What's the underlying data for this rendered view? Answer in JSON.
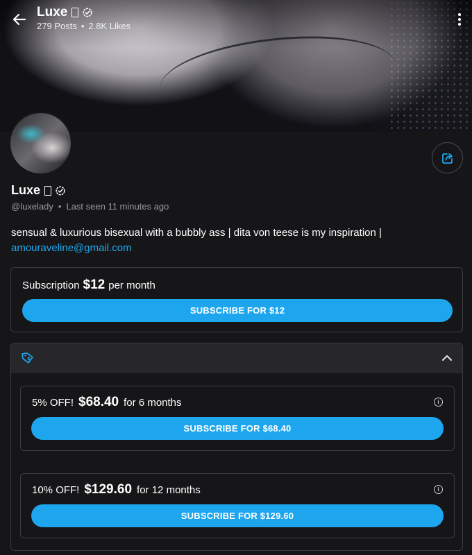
{
  "header": {
    "name": "Luxe",
    "posts": "279 Posts",
    "separator": "•",
    "likes": "2.8K Likes"
  },
  "profile": {
    "name": "Luxe",
    "handle": "@luxelady",
    "separator": "•",
    "last_seen": "Last seen 11 minutes ago",
    "bio_text": "sensual & luxurious bisexual with a bubbly ass | dita von teese is my inspiration |",
    "bio_link": "amouraveline@gmail.com"
  },
  "subscription": {
    "label": "Subscription",
    "price": "$12",
    "period": "per month",
    "button": "SUBSCRIBE FOR $12"
  },
  "bundles": {
    "offers": [
      {
        "discount": "5% OFF!",
        "price": "$68.40",
        "duration": "for 6 months",
        "button": "SUBSCRIBE FOR $68.40"
      },
      {
        "discount": "10% OFF!",
        "price": "$129.60",
        "duration": "for 12 months",
        "button": "SUBSCRIBE FOR $129.60"
      }
    ]
  },
  "icons": {
    "back": "arrow-left-icon",
    "more": "more-vertical-icon",
    "share": "share-icon",
    "verified": "verified-icon",
    "tag": "tag-icon",
    "collapse": "chevron-up-icon",
    "info": "info-icon"
  },
  "colors": {
    "accent": "#1da6ee",
    "link": "#1fa8ee",
    "background": "#161618",
    "card_header": "#27272b"
  }
}
